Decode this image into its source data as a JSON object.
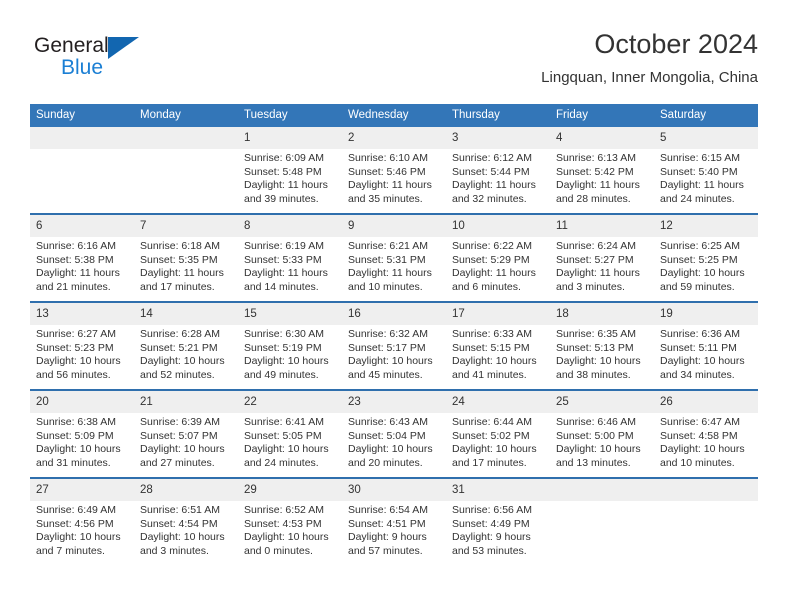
{
  "brand": {
    "word_one": "General",
    "word_two": "Blue",
    "triangle_icon": "brand-triangle-icon"
  },
  "header": {
    "title": "October 2024",
    "subtitle": "Lingquan, Inner Mongolia, China"
  },
  "colors": {
    "header_blue": "#3376b8",
    "row_divider_blue": "#2f6fad",
    "daynum_band": "#efefef",
    "text": "#333333",
    "brand_blue": "#1b7fd4",
    "brand_triangle": "#1266b0"
  },
  "weekdays": [
    "Sunday",
    "Monday",
    "Tuesday",
    "Wednesday",
    "Thursday",
    "Friday",
    "Saturday"
  ],
  "weeks": [
    [
      {
        "day": "",
        "empty": true
      },
      {
        "day": "",
        "empty": true
      },
      {
        "day": "1",
        "sunrise": "Sunrise: 6:09 AM",
        "sunset": "Sunset: 5:48 PM",
        "daylight_line1": "Daylight: 11 hours",
        "daylight_line2": "and 39 minutes."
      },
      {
        "day": "2",
        "sunrise": "Sunrise: 6:10 AM",
        "sunset": "Sunset: 5:46 PM",
        "daylight_line1": "Daylight: 11 hours",
        "daylight_line2": "and 35 minutes."
      },
      {
        "day": "3",
        "sunrise": "Sunrise: 6:12 AM",
        "sunset": "Sunset: 5:44 PM",
        "daylight_line1": "Daylight: 11 hours",
        "daylight_line2": "and 32 minutes."
      },
      {
        "day": "4",
        "sunrise": "Sunrise: 6:13 AM",
        "sunset": "Sunset: 5:42 PM",
        "daylight_line1": "Daylight: 11 hours",
        "daylight_line2": "and 28 minutes."
      },
      {
        "day": "5",
        "sunrise": "Sunrise: 6:15 AM",
        "sunset": "Sunset: 5:40 PM",
        "daylight_line1": "Daylight: 11 hours",
        "daylight_line2": "and 24 minutes."
      }
    ],
    [
      {
        "day": "6",
        "sunrise": "Sunrise: 6:16 AM",
        "sunset": "Sunset: 5:38 PM",
        "daylight_line1": "Daylight: 11 hours",
        "daylight_line2": "and 21 minutes."
      },
      {
        "day": "7",
        "sunrise": "Sunrise: 6:18 AM",
        "sunset": "Sunset: 5:35 PM",
        "daylight_line1": "Daylight: 11 hours",
        "daylight_line2": "and 17 minutes."
      },
      {
        "day": "8",
        "sunrise": "Sunrise: 6:19 AM",
        "sunset": "Sunset: 5:33 PM",
        "daylight_line1": "Daylight: 11 hours",
        "daylight_line2": "and 14 minutes."
      },
      {
        "day": "9",
        "sunrise": "Sunrise: 6:21 AM",
        "sunset": "Sunset: 5:31 PM",
        "daylight_line1": "Daylight: 11 hours",
        "daylight_line2": "and 10 minutes."
      },
      {
        "day": "10",
        "sunrise": "Sunrise: 6:22 AM",
        "sunset": "Sunset: 5:29 PM",
        "daylight_line1": "Daylight: 11 hours",
        "daylight_line2": "and 6 minutes."
      },
      {
        "day": "11",
        "sunrise": "Sunrise: 6:24 AM",
        "sunset": "Sunset: 5:27 PM",
        "daylight_line1": "Daylight: 11 hours",
        "daylight_line2": "and 3 minutes."
      },
      {
        "day": "12",
        "sunrise": "Sunrise: 6:25 AM",
        "sunset": "Sunset: 5:25 PM",
        "daylight_line1": "Daylight: 10 hours",
        "daylight_line2": "and 59 minutes."
      }
    ],
    [
      {
        "day": "13",
        "sunrise": "Sunrise: 6:27 AM",
        "sunset": "Sunset: 5:23 PM",
        "daylight_line1": "Daylight: 10 hours",
        "daylight_line2": "and 56 minutes."
      },
      {
        "day": "14",
        "sunrise": "Sunrise: 6:28 AM",
        "sunset": "Sunset: 5:21 PM",
        "daylight_line1": "Daylight: 10 hours",
        "daylight_line2": "and 52 minutes."
      },
      {
        "day": "15",
        "sunrise": "Sunrise: 6:30 AM",
        "sunset": "Sunset: 5:19 PM",
        "daylight_line1": "Daylight: 10 hours",
        "daylight_line2": "and 49 minutes."
      },
      {
        "day": "16",
        "sunrise": "Sunrise: 6:32 AM",
        "sunset": "Sunset: 5:17 PM",
        "daylight_line1": "Daylight: 10 hours",
        "daylight_line2": "and 45 minutes."
      },
      {
        "day": "17",
        "sunrise": "Sunrise: 6:33 AM",
        "sunset": "Sunset: 5:15 PM",
        "daylight_line1": "Daylight: 10 hours",
        "daylight_line2": "and 41 minutes."
      },
      {
        "day": "18",
        "sunrise": "Sunrise: 6:35 AM",
        "sunset": "Sunset: 5:13 PM",
        "daylight_line1": "Daylight: 10 hours",
        "daylight_line2": "and 38 minutes."
      },
      {
        "day": "19",
        "sunrise": "Sunrise: 6:36 AM",
        "sunset": "Sunset: 5:11 PM",
        "daylight_line1": "Daylight: 10 hours",
        "daylight_line2": "and 34 minutes."
      }
    ],
    [
      {
        "day": "20",
        "sunrise": "Sunrise: 6:38 AM",
        "sunset": "Sunset: 5:09 PM",
        "daylight_line1": "Daylight: 10 hours",
        "daylight_line2": "and 31 minutes."
      },
      {
        "day": "21",
        "sunrise": "Sunrise: 6:39 AM",
        "sunset": "Sunset: 5:07 PM",
        "daylight_line1": "Daylight: 10 hours",
        "daylight_line2": "and 27 minutes."
      },
      {
        "day": "22",
        "sunrise": "Sunrise: 6:41 AM",
        "sunset": "Sunset: 5:05 PM",
        "daylight_line1": "Daylight: 10 hours",
        "daylight_line2": "and 24 minutes."
      },
      {
        "day": "23",
        "sunrise": "Sunrise: 6:43 AM",
        "sunset": "Sunset: 5:04 PM",
        "daylight_line1": "Daylight: 10 hours",
        "daylight_line2": "and 20 minutes."
      },
      {
        "day": "24",
        "sunrise": "Sunrise: 6:44 AM",
        "sunset": "Sunset: 5:02 PM",
        "daylight_line1": "Daylight: 10 hours",
        "daylight_line2": "and 17 minutes."
      },
      {
        "day": "25",
        "sunrise": "Sunrise: 6:46 AM",
        "sunset": "Sunset: 5:00 PM",
        "daylight_line1": "Daylight: 10 hours",
        "daylight_line2": "and 13 minutes."
      },
      {
        "day": "26",
        "sunrise": "Sunrise: 6:47 AM",
        "sunset": "Sunset: 4:58 PM",
        "daylight_line1": "Daylight: 10 hours",
        "daylight_line2": "and 10 minutes."
      }
    ],
    [
      {
        "day": "27",
        "sunrise": "Sunrise: 6:49 AM",
        "sunset": "Sunset: 4:56 PM",
        "daylight_line1": "Daylight: 10 hours",
        "daylight_line2": "and 7 minutes."
      },
      {
        "day": "28",
        "sunrise": "Sunrise: 6:51 AM",
        "sunset": "Sunset: 4:54 PM",
        "daylight_line1": "Daylight: 10 hours",
        "daylight_line2": "and 3 minutes."
      },
      {
        "day": "29",
        "sunrise": "Sunrise: 6:52 AM",
        "sunset": "Sunset: 4:53 PM",
        "daylight_line1": "Daylight: 10 hours",
        "daylight_line2": "and 0 minutes."
      },
      {
        "day": "30",
        "sunrise": "Sunrise: 6:54 AM",
        "sunset": "Sunset: 4:51 PM",
        "daylight_line1": "Daylight: 9 hours",
        "daylight_line2": "and 57 minutes."
      },
      {
        "day": "31",
        "sunrise": "Sunrise: 6:56 AM",
        "sunset": "Sunset: 4:49 PM",
        "daylight_line1": "Daylight: 9 hours",
        "daylight_line2": "and 53 minutes."
      },
      {
        "day": "",
        "empty": true
      },
      {
        "day": "",
        "empty": true
      }
    ]
  ]
}
